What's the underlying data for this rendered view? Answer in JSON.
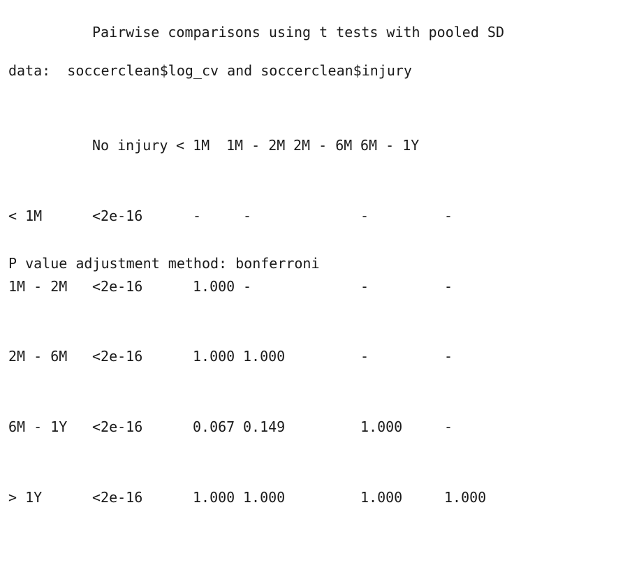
{
  "output": {
    "title": "Pairwise comparisons using t tests with pooled SD",
    "data_line": "data:  soccerclean$log_cv and soccerclean$injury",
    "table": {
      "columns": [
        "No injury",
        "< 1M",
        "1M - 2M",
        "2M - 6M",
        "6M - 1Y"
      ],
      "rows": [
        {
          "label": "< 1M",
          "cells": [
            "<2e-16",
            "-",
            "-",
            "-",
            "-"
          ]
        },
        {
          "label": "1M - 2M",
          "cells": [
            "<2e-16",
            "1.000",
            "-",
            "-",
            "-"
          ]
        },
        {
          "label": "2M - 6M",
          "cells": [
            "<2e-16",
            "1.000",
            "1.000",
            "-",
            "-"
          ]
        },
        {
          "label": "6M - 1Y",
          "cells": [
            "<2e-16",
            "0.067",
            "0.149",
            "1.000",
            "-"
          ]
        },
        {
          "label": "> 1Y",
          "cells": [
            "<2e-16",
            "1.000",
            "1.000",
            "1.000",
            "1.000"
          ]
        }
      ]
    },
    "footer": "P value adjustment method: bonferroni"
  }
}
